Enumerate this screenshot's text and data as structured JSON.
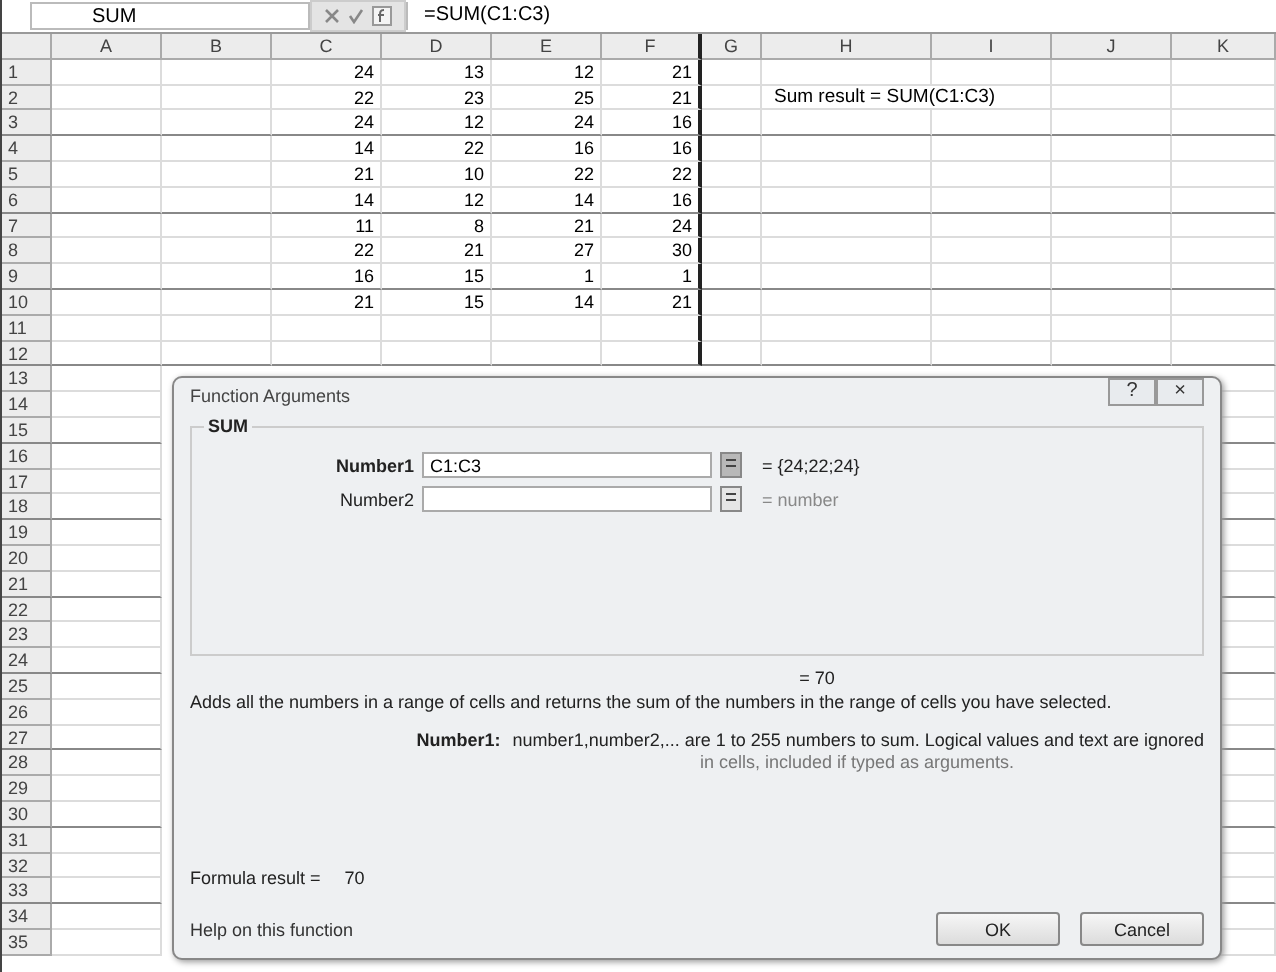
{
  "formula_bar": {
    "name_box": "SUM",
    "formula": "=SUM(C1:C3)"
  },
  "columns": [
    "A",
    "B",
    "C",
    "D",
    "E",
    "F",
    "G",
    "H",
    "I",
    "J",
    "K"
  ],
  "row_numbers": [
    "1",
    "2",
    "3",
    "4",
    "5",
    "6",
    "7",
    "8",
    "9",
    "10",
    "11",
    "12",
    "13",
    "14",
    "15",
    "16",
    "17",
    "18",
    "19",
    "20",
    "21",
    "22",
    "23",
    "24",
    "25",
    "26",
    "27",
    "28",
    "29",
    "30",
    "31",
    "32",
    "33",
    "34",
    "35"
  ],
  "data_rows": [
    {
      "values": [
        "24",
        "13",
        "12",
        "21"
      ]
    },
    {
      "values": [
        "22",
        "23",
        "25",
        "21"
      ]
    },
    {
      "values": [
        "24",
        "12",
        "24",
        "16"
      ]
    },
    {
      "values": [
        "14",
        "22",
        "16",
        "16"
      ]
    },
    {
      "values": [
        "21",
        "10",
        "22",
        "22"
      ]
    },
    {
      "values": [
        "14",
        "12",
        "14",
        "16"
      ]
    },
    {
      "values": [
        "11",
        "8",
        "21",
        "24"
      ]
    },
    {
      "values": [
        "22",
        "21",
        "27",
        "30"
      ]
    },
    {
      "values": [
        "16",
        "15",
        "1",
        "1"
      ]
    },
    {
      "values": [
        "21",
        "15",
        "14",
        "21"
      ]
    }
  ],
  "note": "Sum result = SUM(C1:C3)",
  "dialog": {
    "title": "Function Arguments",
    "help_button": "?",
    "close_button": "×",
    "group": "SUM",
    "arguments": [
      {
        "label": "Number1",
        "value": "C1:C3",
        "result": "= {24;22;24}",
        "active": true
      },
      {
        "label": "Number2",
        "result": "= number",
        "active": false
      }
    ],
    "total": "= 70",
    "description": "Adds all the numbers in a range of cells and returns the sum of the numbers in the range of cells you have selected.",
    "arg_help": {
      "name": "Number1:",
      "text": "number1,number2,... are 1 to 255 numbers to sum. Logical values and text are ignored",
      "note": "in cells, included if typed as arguments."
    },
    "formula_result": {
      "label": "Formula result =",
      "value": "70"
    },
    "help_link": "Help on this function",
    "buttons": [
      "OK",
      "Cancel"
    ]
  }
}
